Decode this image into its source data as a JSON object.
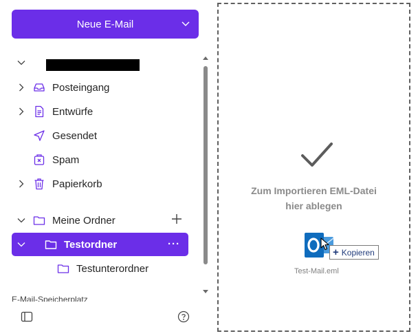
{
  "new_mail": {
    "label": "Neue E-Mail"
  },
  "folders": {
    "inbox": "Posteingang",
    "drafts": "Entwürfe",
    "sent": "Gesendet",
    "spam": "Spam",
    "trash": "Papierkorb",
    "my_folders": "Meine Ordner",
    "selected_folder": "Testordner",
    "subfolder": "Testunterordner"
  },
  "selected_more": "···",
  "storage_label": "E-Mail-Speicherplatz",
  "drop_zone": {
    "line1": "Zum Importieren EML-Datei",
    "line2": "hier ablegen"
  },
  "drag": {
    "file_name": "Test-Mail.eml",
    "copy_label": "Kopieren"
  },
  "colors": {
    "accent": "#6b2ee8"
  }
}
